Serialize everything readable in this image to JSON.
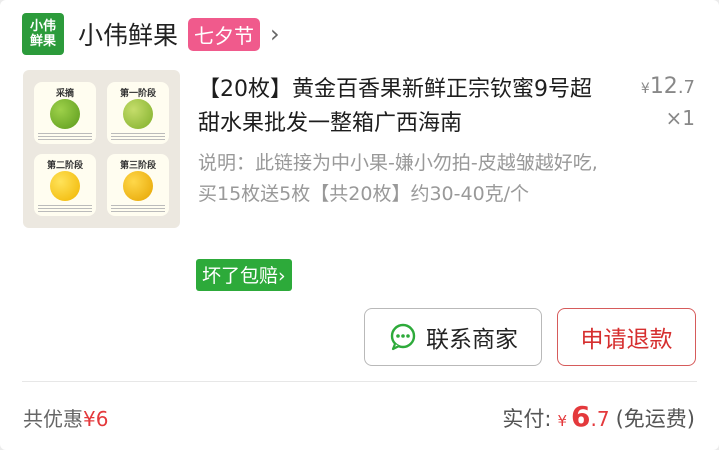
{
  "shop": {
    "logo_line1": "小伟",
    "logo_line2": "鲜果",
    "name": "小伟鲜果",
    "festival_badge": "七夕节",
    "chevron": "›"
  },
  "product": {
    "title": "【20枚】黄金百香果新鲜正宗钦蜜9号超甜水果批发一整箱广西海南",
    "price_currency": "¥",
    "price_int": "12",
    "price_dec": ".7",
    "quantity": "×1",
    "description": "说明：此链接为中小果-嫌小勿拍-皮越皱越好吃,买15枚送5枚【共20枚】约30-40克/个",
    "guarantee_badge": "坏了包赔",
    "guarantee_arrow": "›",
    "image_stages": [
      "采摘",
      "第一阶段",
      "第二阶段",
      "第三阶段"
    ]
  },
  "actions": {
    "contact_label": "联系商家",
    "refund_label": "申请退款"
  },
  "footer": {
    "discount_label": "共优惠",
    "discount_amount": "¥6",
    "paid_label": "实付:",
    "paid_currency": "¥",
    "paid_int": "6",
    "paid_dec": ".7",
    "shipping_note": "(免运费)"
  },
  "colors": {
    "brand_green": "#2c9b3b",
    "badge_pink": "#f05a8c",
    "guarantee_green": "#2daa3a",
    "accent_red": "#e4393c"
  },
  "icons": {
    "chat": "chat-bubble-icon",
    "chevron": "chevron-right-icon"
  }
}
